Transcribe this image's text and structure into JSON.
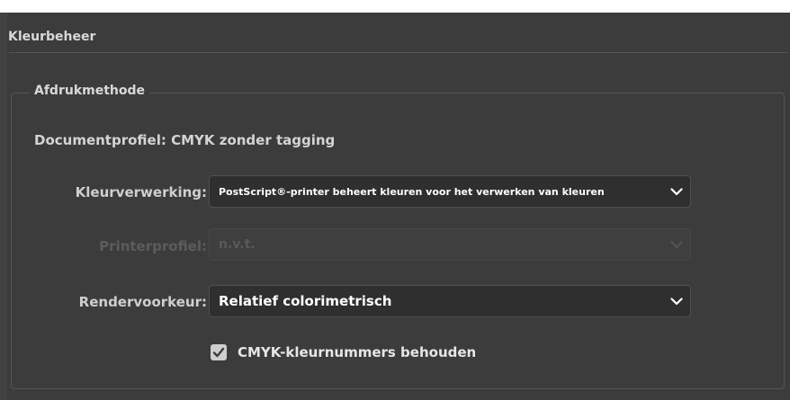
{
  "section": {
    "title": "Kleurbeheer"
  },
  "print_method": {
    "legend": "Afdrukmethode",
    "document_profile": "Documentprofiel: CMYK zonder tagging",
    "color_handling": {
      "label": "Kleurverwerking:",
      "value": "PostScript®-printer beheert kleuren voor het verwerken van kleuren"
    },
    "printer_profile": {
      "label": "Printerprofiel:",
      "value": "n.v.t.",
      "disabled": true
    },
    "render_intent": {
      "label": "Rendervoorkeur:",
      "value": "Relatief colorimetrisch"
    },
    "preserve_cmyk": {
      "label": "CMYK-kleurnummers behouden",
      "checked": true
    }
  },
  "colors": {
    "panel_bg": "#3c3c3c",
    "field_bg": "#2f2f2f",
    "text": "#e0e0e0",
    "disabled_text": "#5a5a5a"
  },
  "icons": {
    "dropdown": "chevron-down-icon",
    "check": "checkmark-icon"
  }
}
